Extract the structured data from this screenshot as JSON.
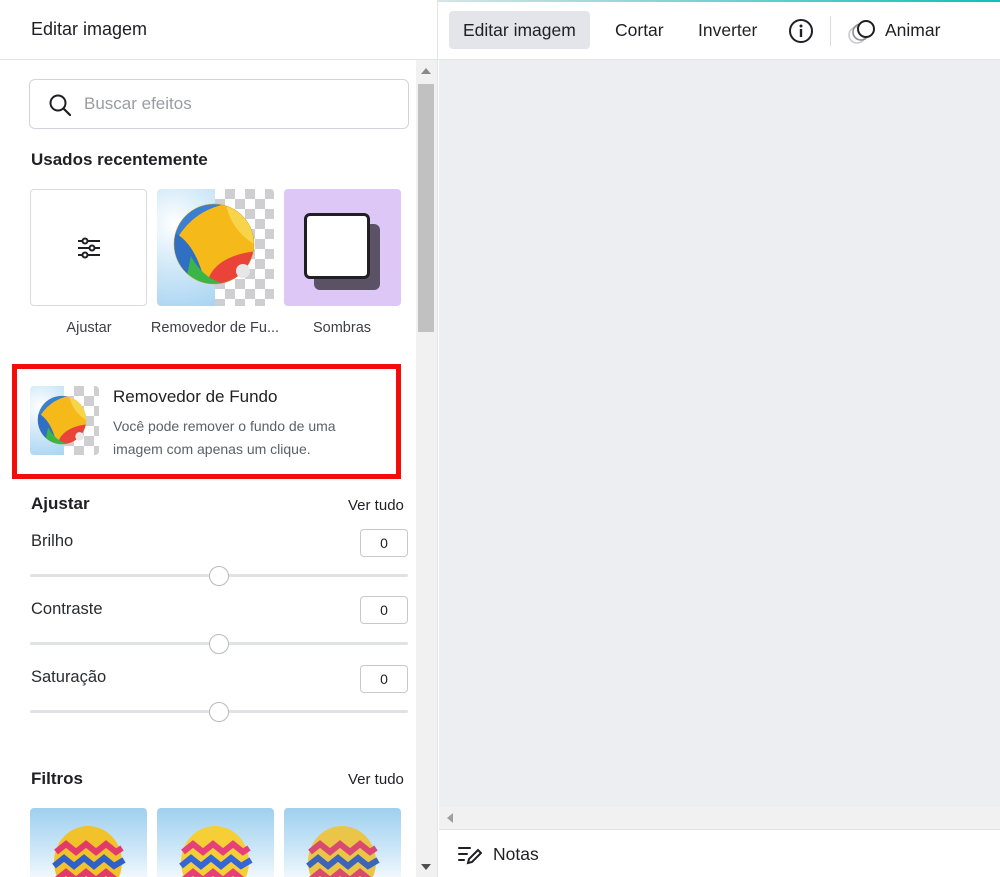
{
  "panel": {
    "title": "Editar imagem",
    "search": {
      "placeholder": "Buscar efeitos",
      "value": ""
    },
    "recent": {
      "title": "Usados recentemente",
      "items": [
        {
          "label": "Ajustar",
          "icon": "sliders-icon"
        },
        {
          "label": "Removedor de Fu...",
          "icon": "beach-ball-transparent"
        },
        {
          "label": "Sombras",
          "icon": "shadow-square"
        }
      ]
    },
    "highlight_card": {
      "title": "Removedor de Fundo",
      "description": "Você pode remover o fundo de uma imagem com apenas um clique.",
      "border_color": "#f30c0c"
    },
    "adjust": {
      "title": "Ajustar",
      "see_all": "Ver tudo",
      "sliders": [
        {
          "label": "Brilho",
          "value": "0"
        },
        {
          "label": "Contraste",
          "value": "0"
        },
        {
          "label": "Saturação",
          "value": "0"
        }
      ]
    },
    "filters": {
      "title": "Filtros",
      "see_all": "Ver tudo"
    }
  },
  "toolbar": {
    "edit_image": "Editar imagem",
    "crop": "Cortar",
    "flip": "Inverter",
    "info_icon": "info-icon",
    "animate": "Animar"
  },
  "notes": {
    "label": "Notas"
  },
  "colors": {
    "accent_teal": "#0ec0b4",
    "highlight_red": "#f30c0c",
    "canvas_bg": "#eceef1",
    "shadow_tile_bg": "#dcc7f6"
  }
}
